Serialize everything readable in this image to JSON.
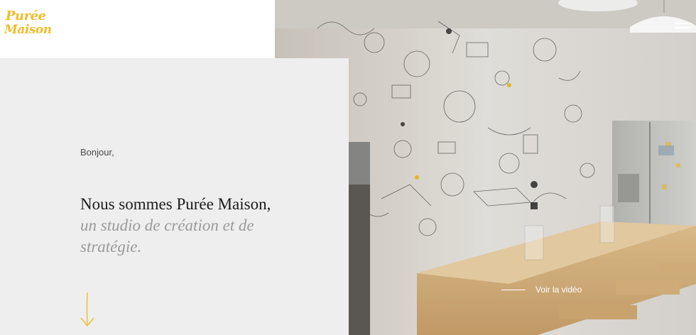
{
  "brand": {
    "logo_line1": "Purée",
    "logo_line2": "Maison",
    "accent_color": "#f0bd2a"
  },
  "intro": {
    "greeting": "Bonjour,",
    "headline": "Nous sommes Purée Maison,",
    "subline": "un studio de création et de stratégie."
  },
  "hero": {
    "video_link_label": "Voir la vidéo"
  },
  "icons": {
    "menu": "hamburger-icon",
    "scroll": "arrow-down-icon"
  }
}
